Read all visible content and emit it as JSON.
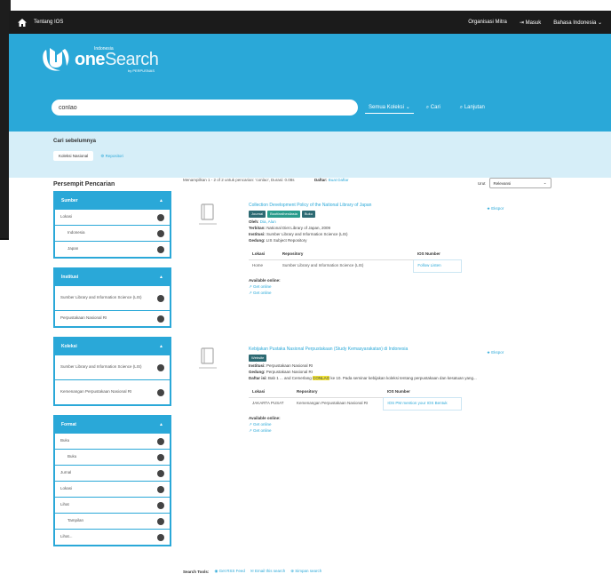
{
  "topbar": {
    "about": "Tentang IOS",
    "partners": "Organisasi Mitra",
    "login": "Masuk",
    "language": "Bahasa Indonesia"
  },
  "logo": {
    "small": "Indonesia",
    "big_main": "one",
    "big_rest": "Search",
    "sub": "by PERPUSNAS"
  },
  "search": {
    "value": "conlao",
    "scope": "Semua Koleksi",
    "go": "Cari",
    "advanced": "Lanjutan"
  },
  "subbar": {
    "label": "Cari sebelumnya",
    "tab_active": "Koleksi Nasional",
    "tab_other": "Repositori"
  },
  "sidebar": {
    "title": "Persempit Pencarian",
    "facets": [
      {
        "name": "Sumber",
        "items": [
          {
            "label": "Lokasi",
            "indent": false
          },
          {
            "label": "Indonesia",
            "indent": true
          },
          {
            "label": "Japan",
            "indent": true
          }
        ]
      },
      {
        "name": "Institusi",
        "items": [
          {
            "label": "Sumber Library and Information Science (LIS)",
            "indent": false
          },
          {
            "label": "Perpustakaan Nasional RI",
            "indent": false
          }
        ]
      },
      {
        "name": "Koleksi",
        "items": [
          {
            "label": "Sumber Library and Information Science (LIS)",
            "indent": false
          },
          {
            "label": "Kemenangan Perpustakaan Nasional RI",
            "indent": false
          }
        ]
      },
      {
        "name": "Format",
        "items": [
          {
            "label": "Buku",
            "indent": false
          },
          {
            "label": "Buku",
            "indent": true
          },
          {
            "label": "Jurnal",
            "indent": false
          },
          {
            "label": "Lokasi",
            "indent": false
          },
          {
            "label": "Lihat",
            "indent": false
          },
          {
            "label": "Tampilan",
            "indent": true
          },
          {
            "label": "Lihat...",
            "indent": false
          }
        ]
      }
    ]
  },
  "results": {
    "summary": "Menampilkan 1 - 2 of 2 untuk pencarian: 'conlao', Durasi: 0.08s",
    "daftar_label": "Daftar:",
    "daftar_links": "Buat Daftar",
    "sort_label": "Urut",
    "sort_value": "Relevansi",
    "records": [
      {
        "title": "Collection Development Policy of the National Library of Japan",
        "tags": [
          "Journal",
          "Bootfardhesilasia",
          "Buku"
        ],
        "oleh_label": "Oleh:",
        "oleh": "Dia, Alun",
        "terbitan_label": "Terbitan:",
        "terbitan": "National Diet Library of Japan, 2009",
        "institusi_label": "Institusi:",
        "institusi": "Sumber Library and Information Science (LIS)",
        "gedung_label": "Gedung:",
        "gedung": "LIS Subject Repository",
        "table_headers": [
          "Lokasi",
          "Repository",
          "IOS Number"
        ],
        "table_row": [
          "Home",
          "Sumber Library and Information Science (LIS)",
          "Follow Listen"
        ],
        "online_label": "Available online:",
        "online_links": [
          "Get online",
          "Get online"
        ],
        "export": "Ekspor"
      },
      {
        "title": "Kebijakan Pustaka Nasional Perpustakaan (Study Kemasyarakatan) di Indonesia",
        "tags": [
          "Website"
        ],
        "institusi_label": "Institusi:",
        "institusi": "Perpustakaan Nasional RI",
        "gedung_label": "Gedung:",
        "gedung": "Perpustakaan Nasional RI",
        "daftar_label": "Daftar isi:",
        "daftar_pre": "Bab 1 ... and Cemerlang",
        "daftar_hl": "CONLAO",
        "daftar_post": "ke 10. Pada seminar kebijakan koleksi tentang perpustakaan dan kesatuan yang...",
        "table_headers": [
          "Lokasi",
          "Repository",
          "IOS Number"
        ],
        "table_row": [
          "JAKARTA PUSAT",
          "Kemenangan Perpustakaan Nasional RI",
          "IOS PM mention your IOS Bentuk"
        ],
        "online_label": "Available online:",
        "online_links": [
          "Get online",
          "Get online"
        ],
        "export": "Ekspor"
      }
    ],
    "search_tools_label": "Search Tools:",
    "search_tools": [
      "Get RSS Feed",
      "Email this search",
      "Simpan search"
    ]
  },
  "colors": {
    "brand": "#2aa8d8",
    "topbar": "#1b1b1b",
    "subbar": "#d6eef8",
    "tag": "#2d6a73",
    "highlight": "#f0e33a"
  }
}
